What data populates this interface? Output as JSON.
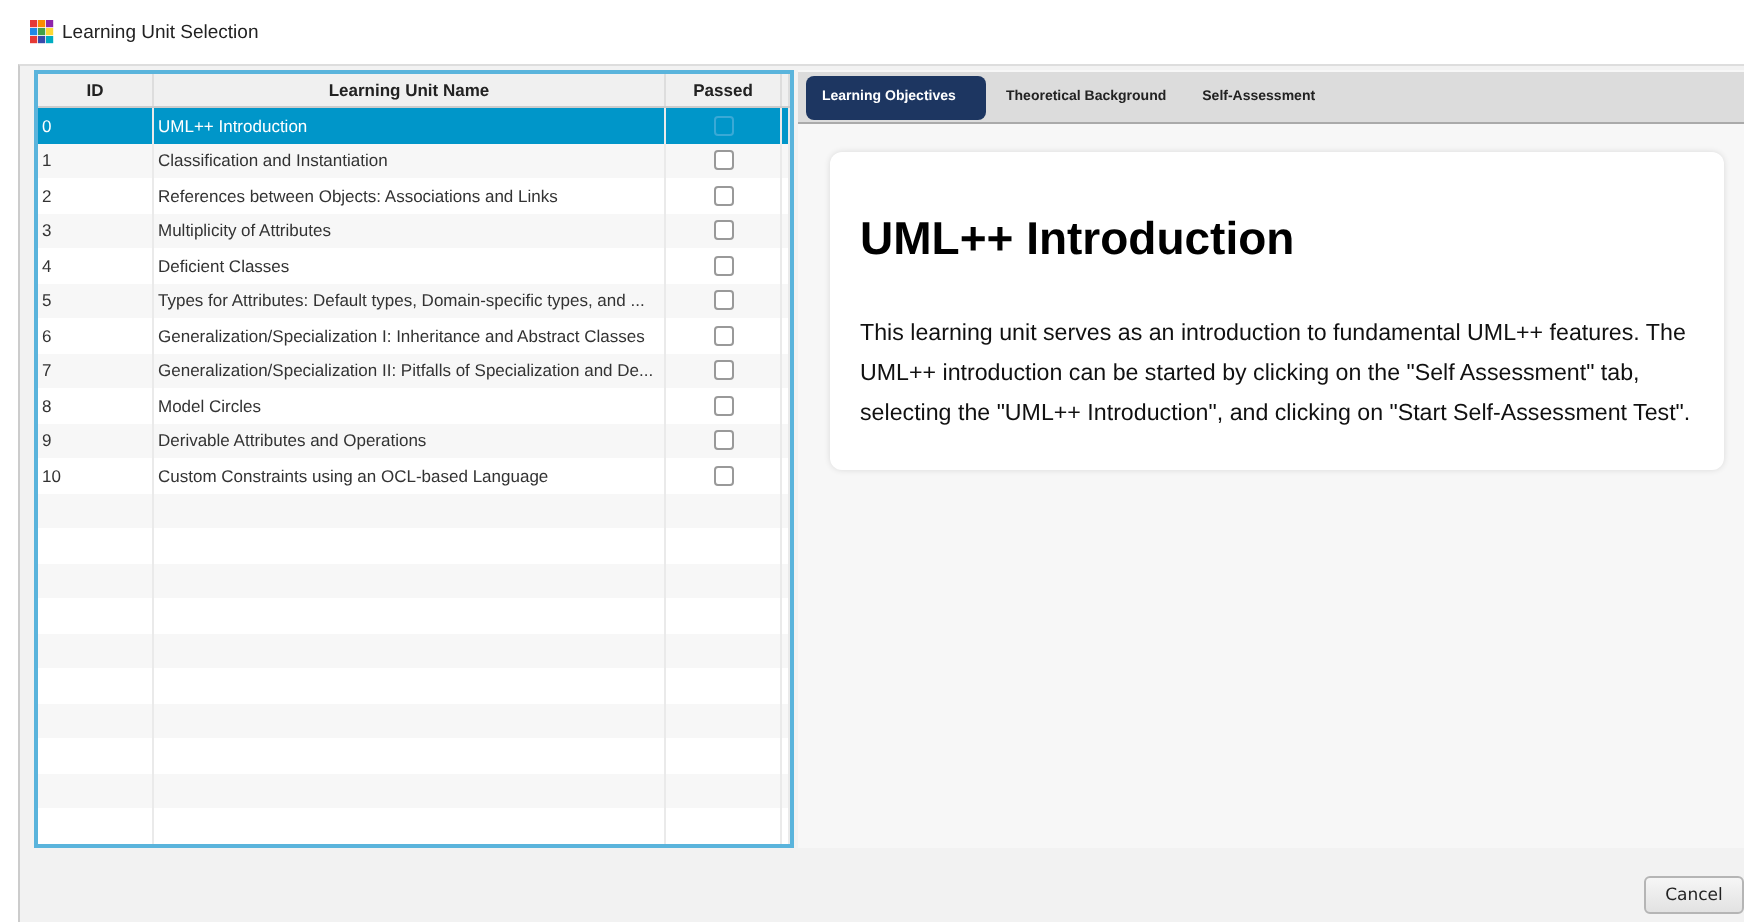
{
  "window": {
    "title": "Learning Unit Selection"
  },
  "table": {
    "columns": [
      "ID",
      "Learning Unit Name",
      "Passed"
    ],
    "rows": [
      {
        "id": "0",
        "name": "UML++ Introduction",
        "passed": false,
        "selected": true
      },
      {
        "id": "1",
        "name": "Classification and Instantiation",
        "passed": false,
        "selected": false
      },
      {
        "id": "2",
        "name": "References between Objects: Associations and Links",
        "passed": false,
        "selected": false
      },
      {
        "id": "3",
        "name": "Multiplicity of Attributes",
        "passed": false,
        "selected": false
      },
      {
        "id": "4",
        "name": "Deficient Classes",
        "passed": false,
        "selected": false
      },
      {
        "id": "5",
        "name": "Types for Attributes: Default types, Domain-specific types, and ...",
        "passed": false,
        "selected": false
      },
      {
        "id": "6",
        "name": "Generalization/Specialization I: Inheritance and Abstract Classes",
        "passed": false,
        "selected": false
      },
      {
        "id": "7",
        "name": "Generalization/Specialization II: Pitfalls of Specialization and De...",
        "passed": false,
        "selected": false
      },
      {
        "id": "8",
        "name": "Model Circles",
        "passed": false,
        "selected": false
      },
      {
        "id": "9",
        "name": "Derivable Attributes and Operations",
        "passed": false,
        "selected": false
      },
      {
        "id": "10",
        "name": "Custom Constraints using an OCL-based Language",
        "passed": false,
        "selected": false
      }
    ]
  },
  "tabs": [
    {
      "label": "Learning Objectives",
      "selected": true
    },
    {
      "label": "Theoretical Background",
      "selected": false
    },
    {
      "label": "Self-Assessment",
      "selected": false
    }
  ],
  "content": {
    "heading": "UML++ Introduction",
    "text": "This learning unit serves as an introduction to fundamental UML++ features. The UML++ introduction can be started by clicking on the \"Self Assessment\" tab, selecting the \"UML++ Introduction\", and clicking on \"Start Self-Assessment Test\"."
  },
  "buttons": [
    "Cancel"
  ]
}
